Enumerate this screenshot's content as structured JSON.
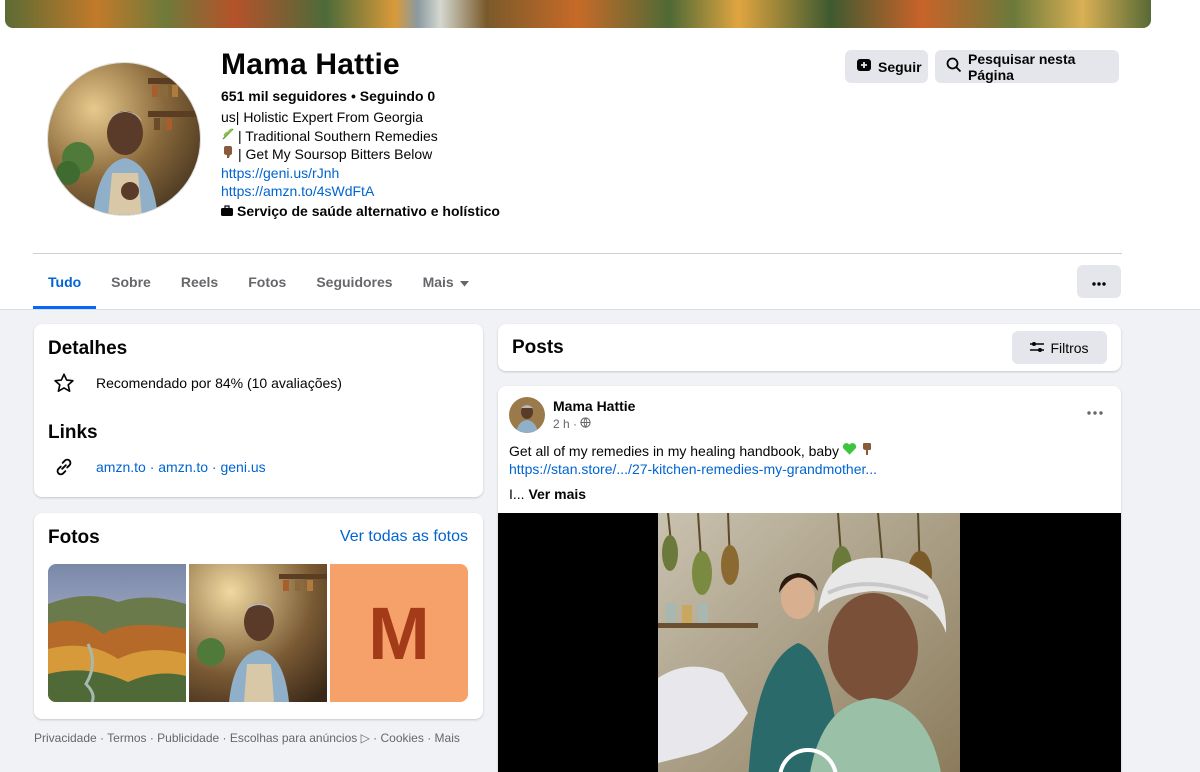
{
  "profile": {
    "name": "Mama Hattie",
    "stats": "651 mil seguidores • Seguindo 0",
    "bio_line1": "us| Holistic Expert From Georgia",
    "bio_line2": "| Traditional Southern Remedies",
    "bio_line3": "| Get My Soursop Bitters Below",
    "link1": "https://geni.us/rJnh",
    "link2": "https://amzn.to/4sWdFtA",
    "category": "Serviço de saúde alternativo e holístico",
    "follow_label": "Seguir",
    "search_label": "Pesquisar nesta Página"
  },
  "tabs": [
    {
      "label": "Tudo"
    },
    {
      "label": "Sobre"
    },
    {
      "label": "Reels"
    },
    {
      "label": "Fotos"
    },
    {
      "label": "Seguidores"
    },
    {
      "label": "Mais"
    }
  ],
  "details": {
    "title": "Detalhes",
    "rating": "Recomendado por 84% (10 avaliações)",
    "links_title": "Links",
    "links_prefix": "amzn.to · amzn.to · geni.us"
  },
  "photos": {
    "title": "Fotos",
    "see_all": "Ver todas as fotos",
    "letter_tile": "M"
  },
  "footer": {
    "text": "Privacidade · Termos · Publicidade · Escolhas para anúncios ▷ · Cookies · Mais"
  },
  "posts": {
    "title": "Posts",
    "filter_label": "Filtros",
    "author": "Mama Hattie",
    "time": "2 h ·",
    "text": "Get all of my remedies in my healing handbook, baby",
    "link": "https://stan.store/.../27-kitchen-remedies-my-grandmother...",
    "more_prefix": "I...",
    "more_label": "Ver mais"
  },
  "colors": {
    "accent": "#0866ff",
    "link": "#0064d1",
    "button_bg": "#e4e6eb",
    "page_bg": "#f0f2f5"
  }
}
